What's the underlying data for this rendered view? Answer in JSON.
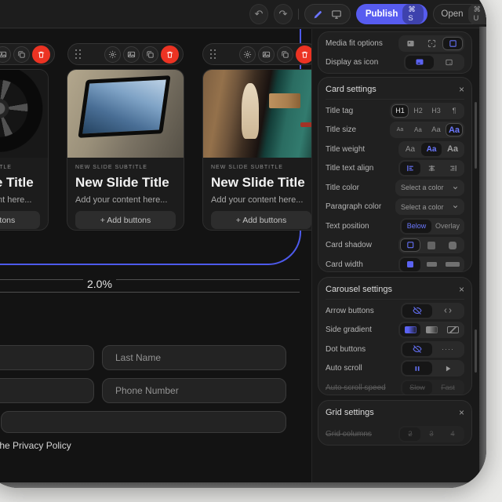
{
  "toolbar": {
    "publish": {
      "label": "Publish",
      "shortcut": "⌘ S"
    },
    "open": {
      "label": "Open",
      "shortcut": "⌘ U"
    }
  },
  "icons": {
    "undo": "↶",
    "redo": "↷",
    "close": "×",
    "paragraph": "¶",
    "dots": "····"
  },
  "slide": {
    "subtitle": "NEW SLIDE SUBTITLE",
    "title": "New Slide Title",
    "body": "Add your content here...",
    "button": "+ Add buttons"
  },
  "ticker": {
    "value": "2.0%"
  },
  "form": {
    "last_name_placeholder": "Last Name",
    "phone_placeholder": "Phone Number",
    "privacy_text": "the Privacy Policy"
  },
  "panel": {
    "media": {
      "fit_label": "Media fit options",
      "display_label": "Display as icon"
    },
    "card": {
      "title": "Card settings",
      "rows": {
        "tag": {
          "label": "Title tag",
          "options": [
            "H1",
            "H2",
            "H3",
            "¶"
          ]
        },
        "size": {
          "label": "Title size",
          "option": "Aa"
        },
        "weight": {
          "label": "Title weight",
          "option": "Aa"
        },
        "align": {
          "label": "Title text align"
        },
        "title_color": {
          "label": "Title color",
          "value": "Select a color"
        },
        "paragraph_color": {
          "label": "Paragraph color",
          "value": "Select a color"
        },
        "position": {
          "label": "Text position",
          "options": [
            "Below",
            "Overlay"
          ]
        },
        "shadow": {
          "label": "Card shadow"
        },
        "width": {
          "label": "Card width"
        }
      }
    },
    "carousel": {
      "title": "Carousel settings",
      "rows": {
        "arrows": {
          "label": "Arrow buttons"
        },
        "gradient": {
          "label": "Side gradient"
        },
        "dots": {
          "label": "Dot buttons"
        },
        "autoscroll": {
          "label": "Auto scroll"
        },
        "speed": {
          "label": "Auto scroll speed",
          "options": [
            "Slow",
            "Fast"
          ]
        }
      }
    },
    "grid": {
      "title": "Grid settings",
      "rows": {
        "columns": {
          "label": "Grid columns",
          "options": [
            "2",
            "3",
            "4"
          ]
        }
      }
    }
  }
}
